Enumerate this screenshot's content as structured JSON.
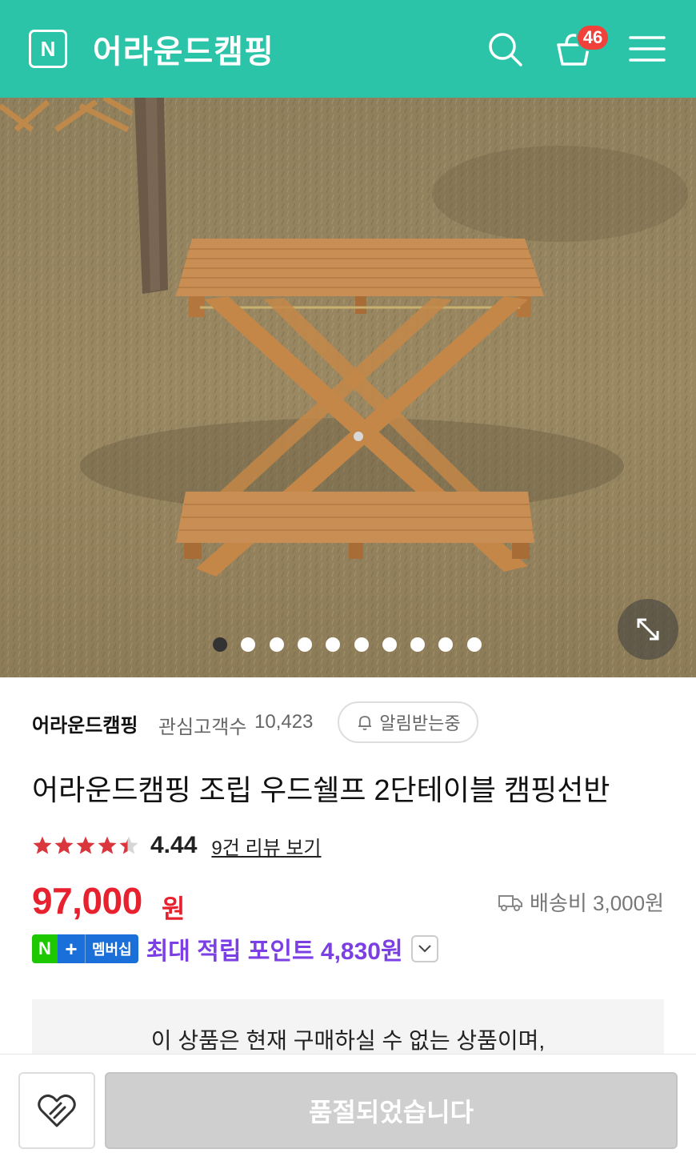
{
  "header": {
    "logo_letter": "N",
    "store_name": "어라운드캠핑",
    "cart_count": "46",
    "icons": [
      "naver-logo-icon",
      "search-icon",
      "cart-icon",
      "menu-icon"
    ],
    "bg_color": "#2bc4a8"
  },
  "gallery": {
    "image_subject": "wooden folding two-tier shelf table on grass",
    "total_images": 10,
    "active_index": 0,
    "expand_icon": "expand-icon"
  },
  "seller": {
    "name": "어라운드캠핑",
    "follower_label": "관심고객수",
    "follower_count": "10,423",
    "alarm_label": "알림받는중",
    "alarm_icon": "bell-icon"
  },
  "product": {
    "title": "어라운드캠핑 조립 우드쉘프 2단테이블 캠핑선반",
    "rating": "4.44",
    "rating_fraction": 0.888,
    "review_link": "9건 리뷰 보기",
    "price": "97,000",
    "price_unit": "원",
    "shipping": "배송비 3,000원",
    "shipping_icon": "truck-icon"
  },
  "membership": {
    "badge_n": "N",
    "badge_plus": "+",
    "badge_label": "멤버십",
    "points_text": "최대 적립 포인트 4,830원",
    "toggle_icon": "chevron-down-icon"
  },
  "notice": {
    "text": "이 상품은 현재 구매하실 수 없는 상품이며,"
  },
  "bottom": {
    "wish_icon": "heart-icon",
    "soldout_label": "품절되었습니다"
  },
  "colors": {
    "accent": "#2bc4a8",
    "price": "#e8212e",
    "points": "#7b3fe4",
    "star": "#d9363e"
  }
}
